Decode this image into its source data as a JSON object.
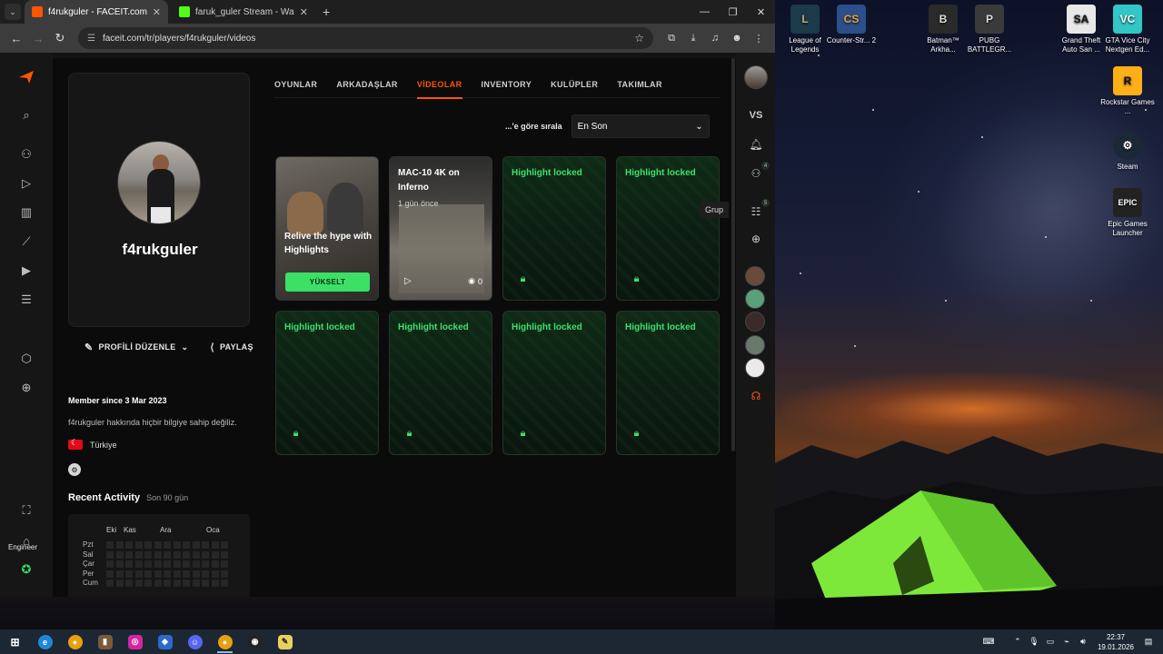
{
  "browser": {
    "tabs": [
      {
        "title": "f4rukguler - FACEIT.com",
        "favicon_color": "#ff5500",
        "active": true
      },
      {
        "title": "faruk_guler Stream - Watch Live",
        "favicon_color": "#53fc18",
        "active": false
      }
    ],
    "url": "faceit.com/tr/players/f4rukguler/videos",
    "new_tab_glyph": "+",
    "window_controls": {
      "minimize": "—",
      "maximize": "❐",
      "close": "✕"
    }
  },
  "profile": {
    "username": "f4rukguler",
    "edit_label": "PROFİLİ DÜZENLE",
    "share_label": "PAYLAŞ",
    "member_since": "Member since 3 Mar 2023",
    "about": "f4rukguler hakkında hiçbir bilgiye sahip değiliz.",
    "country": "Türkiye"
  },
  "activity": {
    "title": "Recent Activity",
    "subtitle": "Son 90 gün",
    "months": [
      "Eki",
      "Kas",
      "Ara",
      "Oca"
    ],
    "days": [
      "Pzt",
      "Sal",
      "Çar",
      "Per",
      "Cum"
    ]
  },
  "tabs": [
    "OYUNLAR",
    "ARKADAŞLAR",
    "VİDEOLAR",
    "INVENTORY",
    "KULÜPLER",
    "TAKIMLAR"
  ],
  "active_tab": "VİDEOLAR",
  "sort": {
    "label": "...'e göre sırala",
    "value": "En Son"
  },
  "promo_card": {
    "title": "Relive the hype with Highlights",
    "button": "YÜKSELT"
  },
  "video_card": {
    "title": "MAC-10 4K on Inferno",
    "time": "1 gün önce",
    "views": "0"
  },
  "locked_label": "Highlight locked",
  "right_rail": {
    "vs_label": "VS",
    "friends_badge": "4",
    "group_badge": "5",
    "tooltip": "Grup"
  },
  "left_nav_bottom_label": "Engineer",
  "desktop_icons": [
    {
      "label": "League of Legends",
      "icon": "league-icon",
      "color": "#1b3a4a"
    },
    {
      "label": "Counter-Str... 2",
      "icon": "cs2-icon",
      "color": "#2a4f8a"
    },
    {
      "label": "Batman™ Arkha...",
      "icon": "batman-icon",
      "color": "#2a2a2a"
    },
    {
      "label": "PUBG BATTLEGR...",
      "icon": "pubg-icon",
      "color": "#3a3a3a"
    },
    {
      "label": "Grand Theft Auto San ...",
      "icon": "gta-sa-icon",
      "color": "#e8e8e8"
    },
    {
      "label": "GTA Vice City Nextgen Ed...",
      "icon": "gta-vc-icon",
      "color": "#33c6c6"
    },
    {
      "label": "Rockstar Games ...",
      "icon": "rockstar-icon",
      "color": "#fcaf17"
    },
    {
      "label": "Steam",
      "icon": "steam-icon",
      "color": "#1b2838"
    },
    {
      "label": "Epic Games Launcher",
      "icon": "epic-icon",
      "color": "#222222"
    }
  ],
  "taskbar": {
    "time": "22:37",
    "date": "19.01.2026"
  },
  "colors": {
    "accent": "#ff5500",
    "locked_green": "#3fe06b"
  }
}
